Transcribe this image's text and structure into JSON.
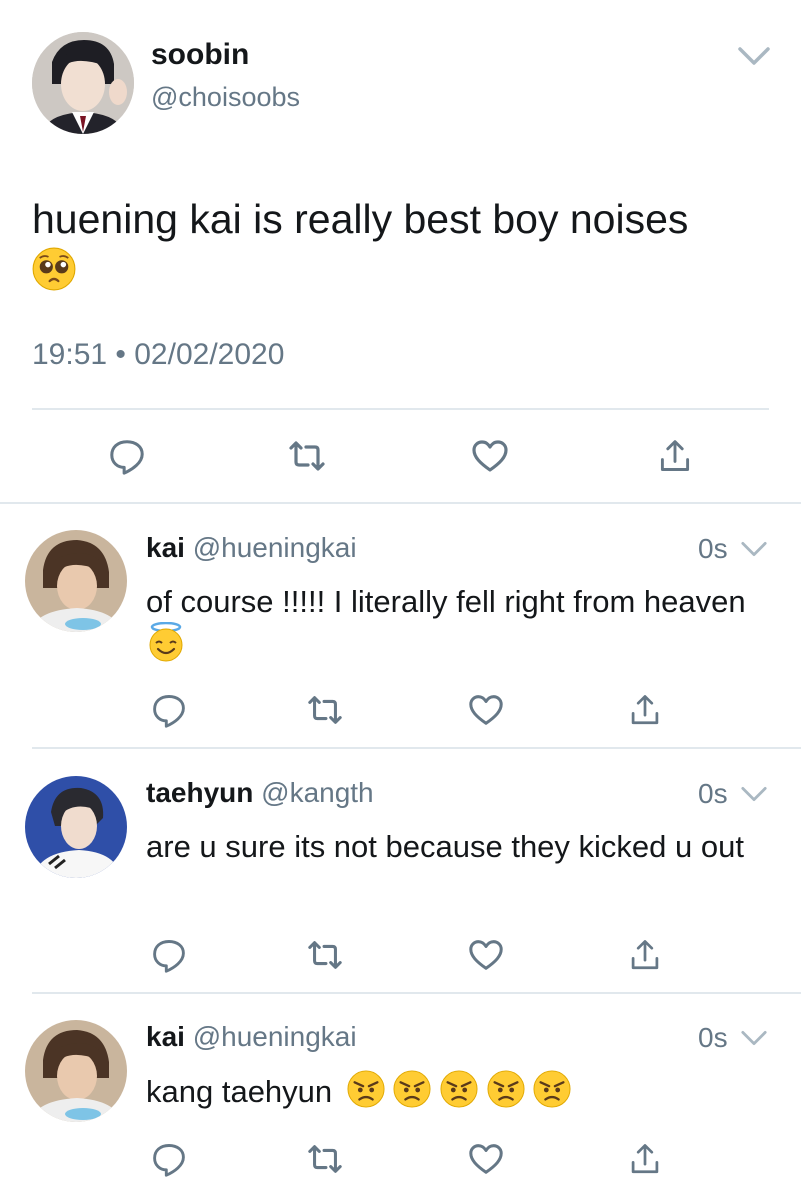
{
  "main_tweet": {
    "display_name": "soobin",
    "handle": "@choisoobs",
    "text": "huening kai is really best boy noises",
    "emoji": "pleading-face",
    "timestamp": "19:51 • 02/02/2020"
  },
  "replies": [
    {
      "display_name": "kai",
      "handle": "@hueningkai",
      "time": "0s",
      "text": "of course !!!!! I literally fell right from heaven",
      "emoji": "smiling-face-with-halo"
    },
    {
      "display_name": "taehyun",
      "handle": "@kangth",
      "time": "0s",
      "text": "are u sure its not because they kicked u out"
    },
    {
      "display_name": "kai",
      "handle": "@hueningkai",
      "time": "0s",
      "text": "kang taehyun",
      "emoji": "angry-face",
      "emoji_count": 5
    }
  ],
  "colors": {
    "text": "#14171a",
    "secondary": "#657786",
    "divider": "#e1e8ed",
    "emoji_yellow": "#ffcc33"
  }
}
